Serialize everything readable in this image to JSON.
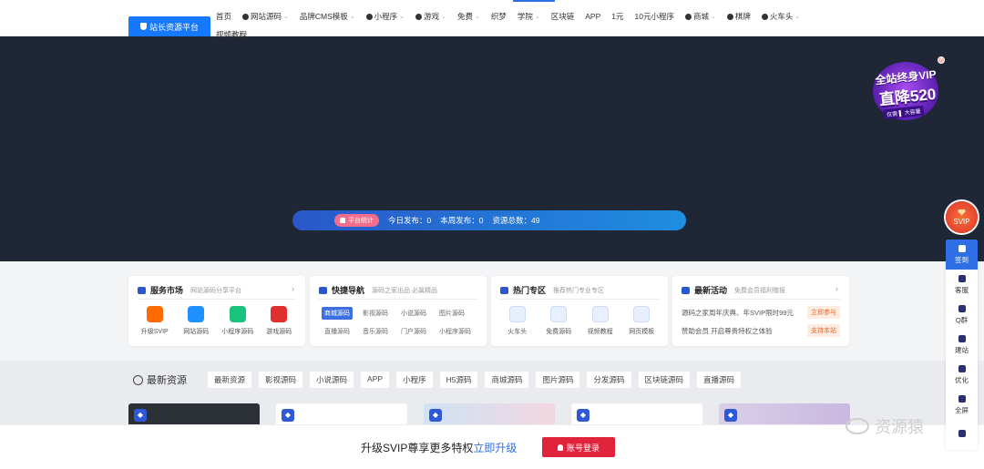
{
  "topbar": {
    "logo_label": "站长资源平台",
    "nav": [
      {
        "label": "首页",
        "icon": "",
        "caret": false
      },
      {
        "label": "网站源码",
        "icon": "globe-icon",
        "caret": true
      },
      {
        "label": "品牌CMS模板",
        "icon": "",
        "caret": true
      },
      {
        "label": "小程序",
        "icon": "wechat-icon",
        "caret": true
      },
      {
        "label": "游戏",
        "icon": "gamepad-icon",
        "caret": true
      },
      {
        "label": "免费",
        "icon": "",
        "caret": true
      },
      {
        "label": "织梦",
        "icon": "",
        "caret": false
      },
      {
        "label": "学院",
        "icon": "",
        "caret": true
      },
      {
        "label": "区块链",
        "icon": "",
        "caret": false
      },
      {
        "label": "APP",
        "icon": "",
        "caret": false
      },
      {
        "label": "1元",
        "icon": "",
        "caret": false
      },
      {
        "label": "10元小程序",
        "icon": "",
        "caret": false
      },
      {
        "label": "商城",
        "icon": "cart-icon",
        "caret": true
      },
      {
        "label": "棋牌",
        "icon": "cards-icon",
        "caret": false
      },
      {
        "label": "火车头",
        "icon": "train-icon",
        "caret": true
      }
    ],
    "nav_second_row": "视频教程"
  },
  "banner": {
    "promo": {
      "line1": "全站终身VIP",
      "line2": "直降520",
      "line3": "仅需 ▌ 大容量"
    },
    "stats": {
      "badge": "平台统计",
      "today_label": "今日发布：",
      "today_value": "0",
      "week_label": "本周发布：",
      "week_value": "0",
      "total_label": "资源总数：",
      "total_value": "49"
    }
  },
  "cards": {
    "market": {
      "title": "服务市场",
      "subtitle": "网站源码分享平台",
      "items": [
        {
          "label": "升级SVIP",
          "icon": "aliyun-icon",
          "color": "#ff6a00"
        },
        {
          "label": "网站源码",
          "icon": "cloud-icon",
          "color": "#1e90ff"
        },
        {
          "label": "小程序源码",
          "icon": "enterprise-icon",
          "color": "#19c37d"
        },
        {
          "label": "游戏源码",
          "icon": "hk-icon",
          "color": "#e0302e"
        }
      ]
    },
    "quicknav": {
      "title": "快捷导航",
      "subtitle": "源码之家出品 必属精品",
      "tags": [
        "商城源码",
        "影视源码",
        "小说源码",
        "图片源码",
        "直播源码",
        "音乐源码",
        "门户源码",
        "小程序源码"
      ]
    },
    "hot": {
      "title": "热门专区",
      "subtitle": "推荐热门专业专区",
      "items": [
        {
          "label": "火车头",
          "icon": "laptop-icon"
        },
        {
          "label": "免费源码",
          "icon": "monitor-icon"
        },
        {
          "label": "视频教程",
          "icon": "send-icon"
        },
        {
          "label": "网页模板",
          "icon": "html5-icon"
        }
      ]
    },
    "events": {
      "title": "最新活动",
      "subtitle": "免费会员福利赠报",
      "rows": [
        {
          "text": "源码之家周年庆典、年SVIP限时99元",
          "action": "立即参与"
        },
        {
          "text": "赞助会员 开启尊贵特权之体验",
          "action": "支持本站"
        }
      ]
    }
  },
  "latest": {
    "title": "最新资源",
    "tabs": [
      "最新资源",
      "影视源码",
      "小说源码",
      "APP",
      "小程序",
      "H5源码",
      "商城源码",
      "图片源码",
      "分发源码",
      "区块链源码",
      "直播源码"
    ]
  },
  "bottom": {
    "message": "升级SVIP尊享更多特权",
    "link": "立即升级",
    "login": "账号登录",
    "watermark": "资源猿"
  },
  "rightbar": {
    "svip": "SVIP",
    "items": [
      "签到",
      "客服",
      "Q群",
      "建站",
      "优化",
      "全屏",
      ""
    ]
  },
  "colors": {
    "primary": "#2f6fe6",
    "banner_bg": "#1f2636",
    "login": "#e0233b"
  }
}
